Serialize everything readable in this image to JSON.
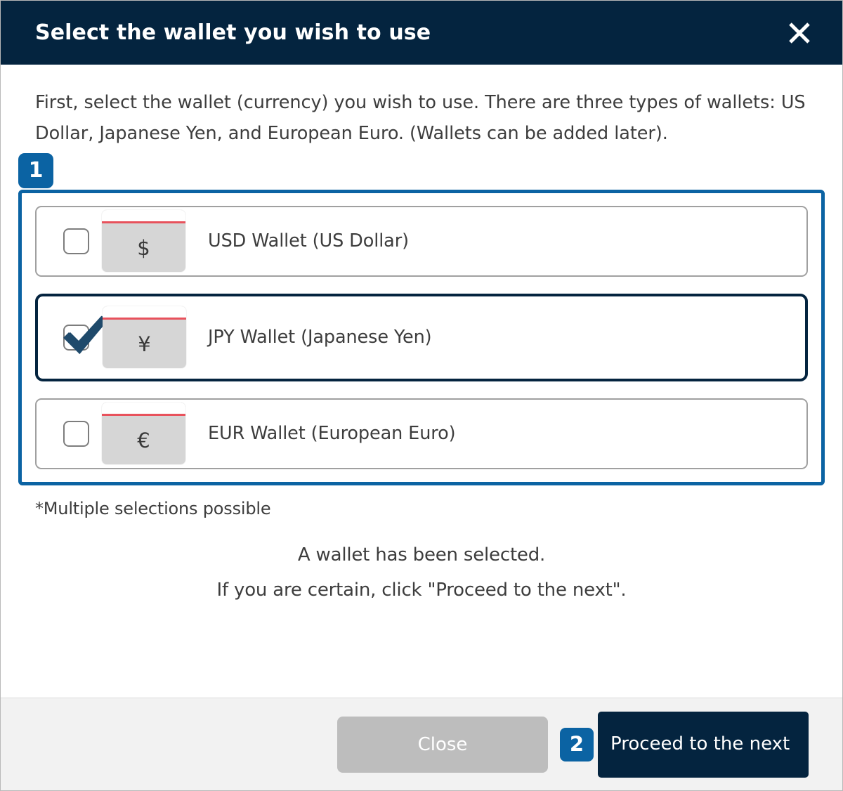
{
  "dialog": {
    "title": "Select the wallet you wish to use",
    "close_icon_label": "close-icon",
    "intro": "First, select the wallet (currency) you wish to use. There are three types of wallets: US Dollar, Japanese Yen, and European Euro. (Wallets can be added later).",
    "note": "*Multiple selections possible",
    "confirm_line1": "A wallet has been selected.",
    "confirm_line2": "If you are certain, click \"Proceed to the next\"."
  },
  "steps": {
    "step1": "1",
    "step2": "2"
  },
  "wallets": [
    {
      "symbol": "$",
      "label": "USD Wallet (US Dollar)",
      "selected": false
    },
    {
      "symbol": "¥",
      "label": "JPY Wallet (Japanese Yen)",
      "selected": true
    },
    {
      "symbol": "€",
      "label": "EUR Wallet (European Euro)",
      "selected": false
    }
  ],
  "footer": {
    "close_label": "Close",
    "proceed_label": "Proceed to the next"
  },
  "colors": {
    "header_navy": "#04243f",
    "accent_blue": "#0b63a3",
    "card_grey": "#d6d6d6",
    "card_red_line": "#e8525c",
    "close_button_grey": "#bdbdbd",
    "footer_grey": "#f2f2f2"
  }
}
